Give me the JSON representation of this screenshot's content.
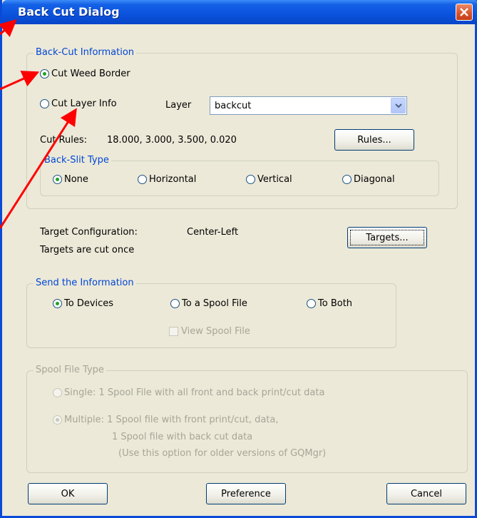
{
  "window": {
    "title": "Back Cut Dialog"
  },
  "backcut": {
    "legend": "Back-Cut Information",
    "cut_weed_border": "Cut Weed Border",
    "cut_layer_info": "Cut Layer Info",
    "layer_label": "Layer",
    "layer_value": "backcut",
    "cut_rules_label": "Cut Rules:",
    "cut_rules_value": "18.000,  3.000,  3.500,  0.020",
    "rules_button": "Rules...",
    "selected": "Cut Weed Border"
  },
  "backslit": {
    "legend": "Back-Slit Type",
    "options": [
      "None",
      "Horizontal",
      "Vertical",
      "Diagonal"
    ],
    "selected": "None"
  },
  "targets": {
    "config_label": "Target Configuration:",
    "config_value": "Center-Left",
    "cut_once": "Targets are cut once",
    "button": "Targets..."
  },
  "send": {
    "legend": "Send the Information",
    "options": [
      "To Devices",
      "To a Spool File",
      "To Both"
    ],
    "selected": "To Devices",
    "view_spool": "View Spool File",
    "view_spool_checked": false
  },
  "spool": {
    "legend": "Spool File Type",
    "single": "Single:  1 Spool File with all front and back print/cut data",
    "multiple_line1": "Multiple: 1 Spool file with front print/cut, data,",
    "multiple_line2": "1 Spool file with back cut data",
    "multiple_line3": "(Use this option for older versions of GQMgr)",
    "selected": "Multiple",
    "enabled": false
  },
  "footer": {
    "ok": "OK",
    "preference": "Preference",
    "cancel": "Cancel"
  },
  "colors": {
    "title_blue": "#0a52dc",
    "annotation_arrow": "#ff0000",
    "legend_blue": "#0046d5"
  }
}
